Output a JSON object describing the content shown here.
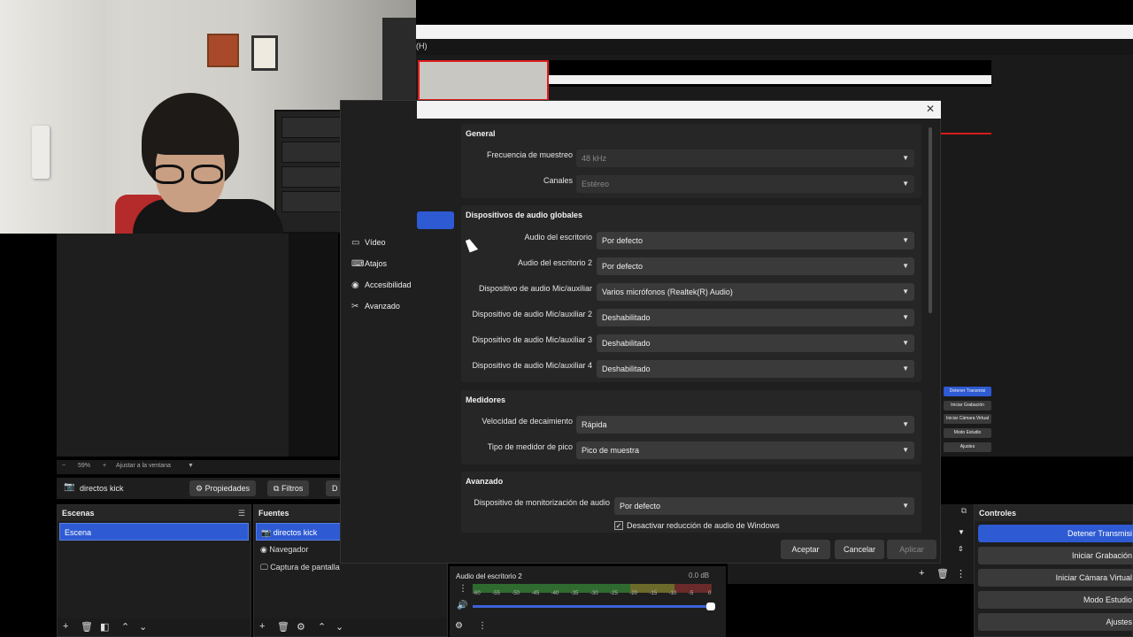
{
  "menubar": {
    "help_fragment": "(H)"
  },
  "zoom": {
    "level": "59%",
    "fit_label": "Ajustar a la ventana"
  },
  "source_toolbar": {
    "source_name": "directos kick",
    "properties_label": "Propiedades",
    "filters_label": "Filtros",
    "extra_label": "D"
  },
  "scenes": {
    "title": "Escenas",
    "items": [
      {
        "label": "Escena",
        "selected": true
      }
    ]
  },
  "sources": {
    "title": "Fuentes",
    "items": [
      {
        "label": "directos kick",
        "icon": "camera-icon",
        "selected": true
      },
      {
        "label": "Navegador",
        "icon": "globe-icon",
        "selected": false
      },
      {
        "label": "Captura de pantalla",
        "icon": "monitor-icon",
        "selected": false
      }
    ]
  },
  "controls": {
    "title": "Controles",
    "buttons": [
      {
        "label": "Detener Transmisi",
        "active": true
      },
      {
        "label": "Iniciar Grabación",
        "active": false
      },
      {
        "label": "Iniciar Cámara Virtual",
        "active": false
      },
      {
        "label": "Modo Estudio",
        "active": false
      },
      {
        "label": "Ajustes",
        "active": false
      }
    ]
  },
  "mixer": {
    "channel_name": "Audio del escritorio 2",
    "db": "0.0 dB",
    "ticks": [
      "-60",
      "-55",
      "-50",
      "-45",
      "-40",
      "-35",
      "-30",
      "-25",
      "-20",
      "-15",
      "-10",
      "-5",
      "0"
    ],
    "volume_fraction": 1.0
  },
  "settings": {
    "nav": [
      {
        "label": "Vídeo",
        "icon": "monitor-icon"
      },
      {
        "label": "Atajos",
        "icon": "keyboard-icon"
      },
      {
        "label": "Accesibilidad",
        "icon": "accessibility-icon"
      },
      {
        "label": "Avanzado",
        "icon": "wrench-icon"
      }
    ],
    "general": {
      "title": "General",
      "sample_rate_label": "Frecuencia de muestreo",
      "sample_rate_value": "48 kHz",
      "channels_label": "Canales",
      "channels_value": "Estéreo"
    },
    "global_devices": {
      "title": "Dispositivos de audio globales",
      "rows": [
        {
          "label": "Audio del escritorio",
          "value": "Por defecto"
        },
        {
          "label": "Audio del escritorio 2",
          "value": "Por defecto"
        },
        {
          "label": "Dispositivo de audio Mic/auxiliar",
          "value": "Varios micrófonos (Realtek(R) Audio)"
        },
        {
          "label": "Dispositivo de audio Mic/auxiliar 2",
          "value": "Deshabilitado"
        },
        {
          "label": "Dispositivo de audio Mic/auxiliar 3",
          "value": "Deshabilitado"
        },
        {
          "label": "Dispositivo de audio Mic/auxiliar 4",
          "value": "Deshabilitado"
        }
      ]
    },
    "meters": {
      "title": "Medidores",
      "decay_label": "Velocidad de decaimiento",
      "decay_value": "Rápida",
      "peak_label": "Tipo de medidor de pico",
      "peak_value": "Pico de muestra"
    },
    "advanced": {
      "title": "Avanzado",
      "monitor_label": "Dispositivo de monitorización de audio",
      "monitor_value": "Por defecto",
      "ducking_label": "Desactivar reducción de audio de Windows",
      "ducking_checked": true
    },
    "buttons": {
      "accept": "Aceptar",
      "cancel": "Cancelar",
      "apply": "Aplicar"
    }
  },
  "preview_right": {
    "buttons": [
      "Detener Transmisi",
      "Iniciar Grabación",
      "Iniciar Cámara Virtual",
      "Modo Estudio",
      "Ajustes"
    ]
  }
}
